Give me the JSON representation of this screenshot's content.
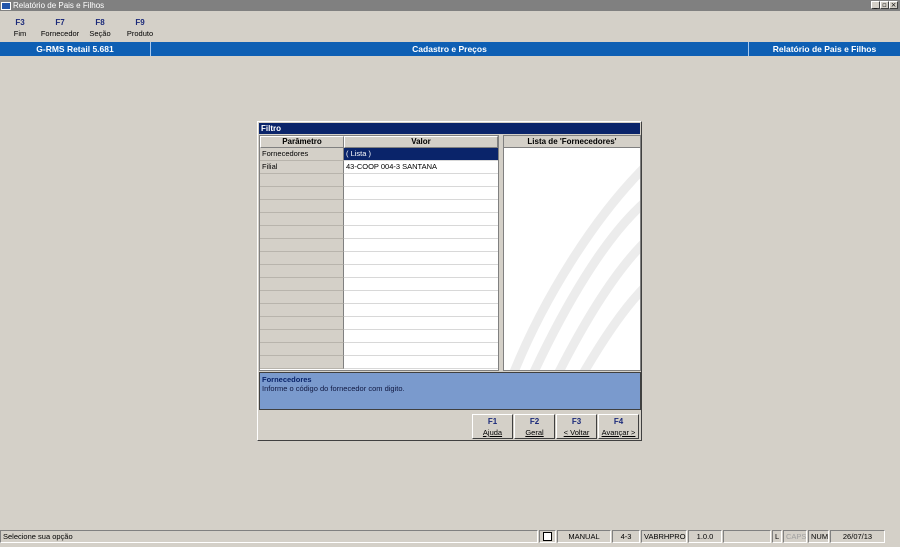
{
  "window": {
    "title": "Relatório de Pais e Filhos",
    "buttons": [
      "_",
      "▫",
      "×"
    ]
  },
  "toolbar": [
    {
      "key": "F3",
      "label": "Fim"
    },
    {
      "key": "F7",
      "label": "Fornecedor"
    },
    {
      "key": "F8",
      "label": "Seção"
    },
    {
      "key": "F9",
      "label": "Produto"
    }
  ],
  "header": {
    "app": "G-RMS Retail 5.681",
    "module": "Cadastro e Preços",
    "report": "Relatório de Pais e Filhos"
  },
  "dialog": {
    "title": "Filtro",
    "columns": {
      "param": "Parâmetro",
      "value": "Valor"
    },
    "rows": [
      {
        "param": "Fornecedores",
        "value": "( Lista )"
      },
      {
        "param": "Filial",
        "value": "43-COOP 004-3  SANTANA"
      },
      {
        "param": "",
        "value": ""
      },
      {
        "param": "",
        "value": ""
      },
      {
        "param": "",
        "value": ""
      },
      {
        "param": "",
        "value": ""
      },
      {
        "param": "",
        "value": ""
      },
      {
        "param": "",
        "value": ""
      },
      {
        "param": "",
        "value": ""
      },
      {
        "param": "",
        "value": ""
      },
      {
        "param": "",
        "value": ""
      },
      {
        "param": "",
        "value": ""
      },
      {
        "param": "",
        "value": ""
      },
      {
        "param": "",
        "value": ""
      },
      {
        "param": "",
        "value": ""
      },
      {
        "param": "",
        "value": ""
      },
      {
        "param": "",
        "value": ""
      }
    ],
    "list_title": "Lista de 'Fornecedores'",
    "help": {
      "title": "Fornecedores",
      "text": "Informe o código do fornecedor com digito."
    },
    "buttons": [
      {
        "key": "F1",
        "label": "Ajuda"
      },
      {
        "key": "F2",
        "label": "Geral"
      },
      {
        "key": "F3",
        "label": "< Voltar"
      },
      {
        "key": "F4",
        "label": "Avançar >"
      }
    ]
  },
  "statusbar": {
    "message": "Selecione sua opção",
    "mode": "MANUAL",
    "code": "4-3",
    "program": "VABRHPRO",
    "version": "1.0.0",
    "blank": "",
    "l": "L",
    "caps": "CAPS",
    "num": "NUM",
    "date": "26/07/13"
  }
}
